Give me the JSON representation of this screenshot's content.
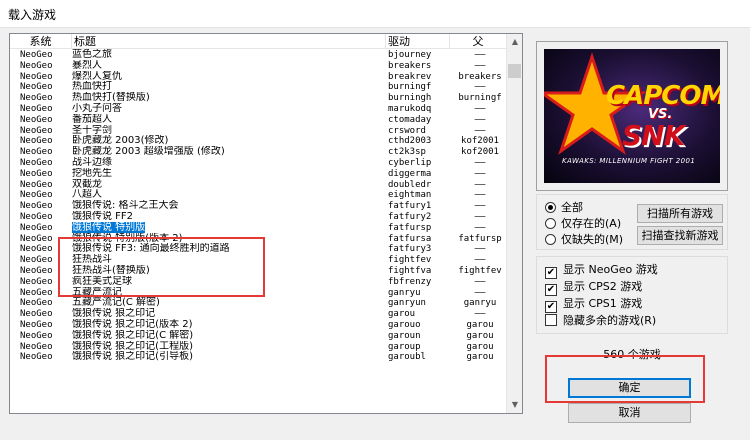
{
  "window": {
    "title": "载入游戏"
  },
  "columns": {
    "system": "系统",
    "title": "标题",
    "driver": "驱动",
    "parent": "父"
  },
  "rows": [
    {
      "system": "NeoGeo",
      "title": "蓝色之旅",
      "driver": "bjourney",
      "parent": "——"
    },
    {
      "system": "NeoGeo",
      "title": "暴烈人",
      "driver": "breakers",
      "parent": "——"
    },
    {
      "system": "NeoGeo",
      "title": "爆烈人复仇",
      "driver": "breakrev",
      "parent": "breakers"
    },
    {
      "system": "NeoGeo",
      "title": "热血快打",
      "driver": "burningf",
      "parent": "——"
    },
    {
      "system": "NeoGeo",
      "title": "热血快打(替换版)",
      "driver": "burningh",
      "parent": "burningf"
    },
    {
      "system": "NeoGeo",
      "title": "小丸子问答",
      "driver": "marukodq",
      "parent": "——"
    },
    {
      "system": "NeoGeo",
      "title": "番茄超人",
      "driver": "ctomaday",
      "parent": "——"
    },
    {
      "system": "NeoGeo",
      "title": "圣十字剑",
      "driver": "crsword",
      "parent": "——"
    },
    {
      "system": "NeoGeo",
      "title": "卧虎藏龙 2003(修改)",
      "driver": "cthd2003",
      "parent": "kof2001"
    },
    {
      "system": "NeoGeo",
      "title": "卧虎藏龙 2003 超级增强版 (修改)",
      "driver": "ct2k3sp",
      "parent": "kof2001"
    },
    {
      "system": "NeoGeo",
      "title": "战斗边缘",
      "driver": "cyberlip",
      "parent": "——"
    },
    {
      "system": "NeoGeo",
      "title": "挖地先生",
      "driver": "diggerma",
      "parent": "——"
    },
    {
      "system": "NeoGeo",
      "title": "双截龙",
      "driver": "doubledr",
      "parent": "——"
    },
    {
      "system": "NeoGeo",
      "title": "八超人",
      "driver": "eightman",
      "parent": "——"
    },
    {
      "system": "NeoGeo",
      "title": "饿狼传说: 格斗之王大会",
      "driver": "fatfury1",
      "parent": "——"
    },
    {
      "system": "NeoGeo",
      "title": "饿狼传说 FF2",
      "driver": "fatfury2",
      "parent": "——"
    },
    {
      "system": "NeoGeo",
      "title": "饿狼传说 特别版",
      "driver": "fatfursp",
      "parent": "——"
    },
    {
      "system": "NeoGeo",
      "title": "饿狼传说 特别版(版本 2)",
      "driver": "fatfursa",
      "parent": "fatfursp"
    },
    {
      "system": "NeoGeo",
      "title": "饿狼传说 FF3: 通向最终胜利的道路",
      "driver": "fatfury3",
      "parent": "——"
    },
    {
      "system": "NeoGeo",
      "title": "狂热战斗",
      "driver": "fightfev",
      "parent": "——"
    },
    {
      "system": "NeoGeo",
      "title": "狂热战斗(替换版)",
      "driver": "fightfva",
      "parent": "fightfev"
    },
    {
      "system": "NeoGeo",
      "title": "疯狂美式足球",
      "driver": "fbfrenzy",
      "parent": "——"
    },
    {
      "system": "NeoGeo",
      "title": "五藏严流记",
      "driver": "ganryu",
      "parent": "——"
    },
    {
      "system": "NeoGeo",
      "title": "五藏严流记(C 解密)",
      "driver": "ganryun",
      "parent": "ganryu"
    },
    {
      "system": "NeoGeo",
      "title": "饿狼传说 狼之印记",
      "driver": "garou",
      "parent": "——"
    },
    {
      "system": "NeoGeo",
      "title": "饿狼传说 狼之印记(版本 2)",
      "driver": "garouo",
      "parent": "garou"
    },
    {
      "system": "NeoGeo",
      "title": "饿狼传说 狼之印记(C 解密)",
      "driver": "garoun",
      "parent": "garou"
    },
    {
      "system": "NeoGeo",
      "title": "饿狼传说 狼之印记(工程版)",
      "driver": "garoup",
      "parent": "garou"
    },
    {
      "system": "NeoGeo",
      "title": "饿狼传说 狼之印记(引导板)",
      "driver": "garoubl",
      "parent": "garou"
    }
  ],
  "preview": {
    "brand1": "CAPCOM",
    "vs": "VS.",
    "brand2": "SNK",
    "subtitle": "KAWAKS: MILLENNIUM FIGHT 2001"
  },
  "filter": {
    "options": [
      "全部",
      "仅存在的(A)",
      "仅缺失的(M)"
    ],
    "selected": 0,
    "scan_all_label": "扫描所有游戏",
    "scan_new_label": "扫描查找新游戏"
  },
  "show": {
    "items": [
      {
        "label": "显示 NeoGeo 游戏",
        "checked": true
      },
      {
        "label": "显示 CPS2 游戏",
        "checked": true
      },
      {
        "label": "显示 CPS1 游戏",
        "checked": true
      },
      {
        "label": "隐藏多余的游戏(R)",
        "checked": false
      }
    ]
  },
  "status": {
    "count": "560 个游戏"
  },
  "actions": {
    "ok_label": "确定",
    "cancel_label": "取消"
  },
  "colors": {
    "highlight": "#e53935",
    "selection": "#0078d7"
  }
}
